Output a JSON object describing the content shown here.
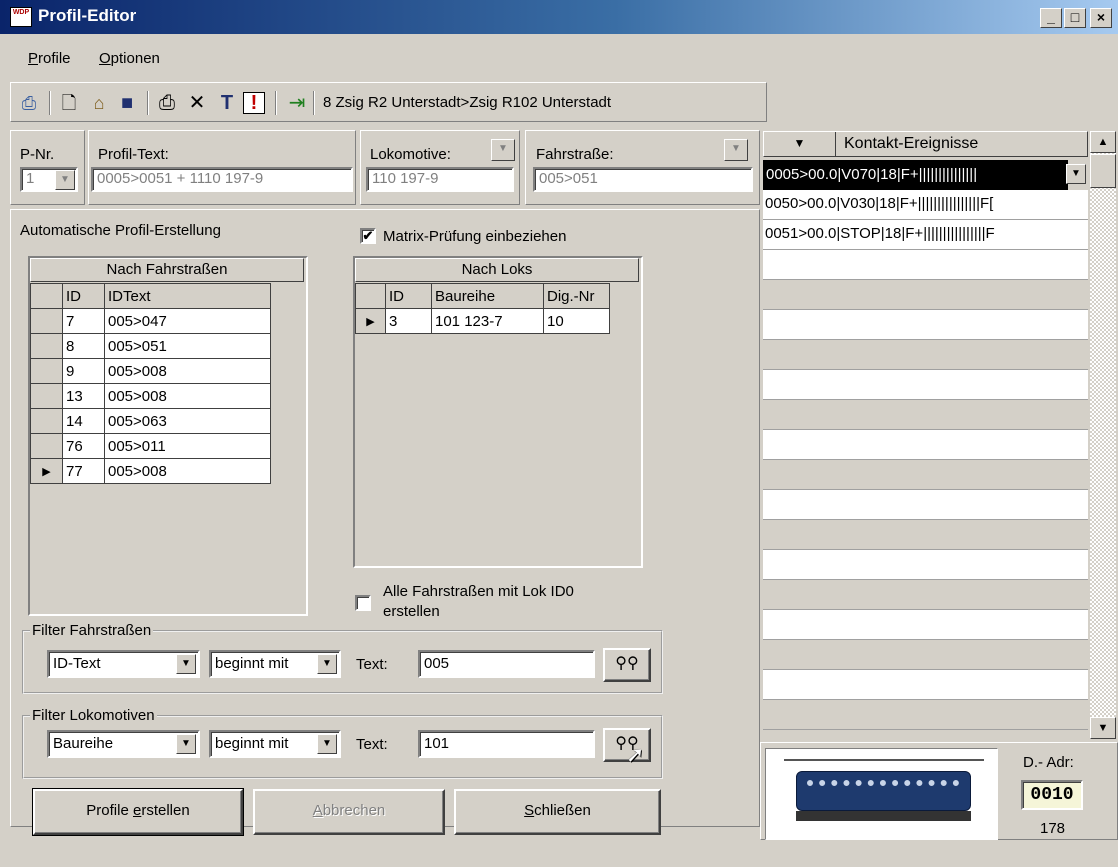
{
  "window": {
    "title": "Profil-Editor",
    "app_icon_text": "WDP",
    "minimize": "_",
    "maximize": "□",
    "close": "×"
  },
  "menu": {
    "items": [
      {
        "accel": "P",
        "rest": "rofile"
      },
      {
        "accel": "O",
        "rest": "ptionen"
      }
    ]
  },
  "toolbar": {
    "status_text": "8 Zsig R2 Unterstadt>Zsig R102 Unterstadt",
    "icons": [
      "print-preview-icon",
      "new-document-icon",
      "building-icon",
      "save-icon",
      "printer-icon",
      "delete-icon",
      "text-icon",
      "alert-icon",
      "exit-icon"
    ]
  },
  "header_fields": {
    "pnr_label": "P-Nr.",
    "pnr_value": "1",
    "profiltext_label": "Profil-Text:",
    "profiltext_value": "0005>0051 + 1110 197-9",
    "lok_label": "Lokomotive:",
    "lok_value": "110 197-9",
    "fahrstrasse_label": "Fahrstraße:",
    "fahrstrasse_value": "005>051"
  },
  "auto": {
    "heading": "Automatische Profil-Erstellung",
    "matrix_check_label": "Matrix-Prüfung einbeziehen",
    "matrix_checked": true,
    "alle_check_line1": "Alle Fahrstraßen mit Lok ID0",
    "alle_check_line2": "erstellen",
    "alle_checked": false
  },
  "grid_fahrstrassen": {
    "title": "Nach Fahrstraßen",
    "columns": [
      "ID",
      "IDText"
    ],
    "rows": [
      {
        "id": "7",
        "text": "005>047"
      },
      {
        "id": "8",
        "text": "005>051"
      },
      {
        "id": "9",
        "text": "005>008"
      },
      {
        "id": "13",
        "text": "005>008"
      },
      {
        "id": "14",
        "text": "005>063"
      },
      {
        "id": "76",
        "text": "005>011"
      },
      {
        "id": "77",
        "text": "005>008"
      }
    ],
    "current_row": 6
  },
  "grid_loks": {
    "title": "Nach Loks",
    "columns": [
      "ID",
      "Baureihe",
      "Dig.-Nr"
    ],
    "rows": [
      {
        "id": "3",
        "baureihe": "101 123-7",
        "dig": "10"
      }
    ],
    "current_row": 0
  },
  "filter_fahrstrassen": {
    "legend": "Filter Fahrstraßen",
    "field": "ID-Text",
    "mode": "beginnt mit",
    "text_label": "Text:",
    "text_value": "005"
  },
  "filter_lokomotiven": {
    "legend": "Filter Lokomotiven",
    "field": "Baureihe",
    "mode": "beginnt mit",
    "text_label": "Text:",
    "text_value": "101"
  },
  "buttons": {
    "create": {
      "pre": "Profile ",
      "accel": "e",
      "post": "rstellen"
    },
    "cancel": {
      "pre": "",
      "accel": "A",
      "post": "bbrechen"
    },
    "close": {
      "pre": "",
      "accel": "S",
      "post": "chließen"
    }
  },
  "kontakt": {
    "header": "Kontakt-Ereignisse",
    "rows": [
      "0005>00.0|V070|18|F+|||||||||||||||",
      "0050>00.0|V030|18|F+||||||||||||||||F[",
      "0051>00.0|STOP|18|F+||||||||||||||||F"
    ]
  },
  "loco": {
    "dadr_label": "D.- Adr:",
    "dadr_value": "0010",
    "number": "178"
  }
}
